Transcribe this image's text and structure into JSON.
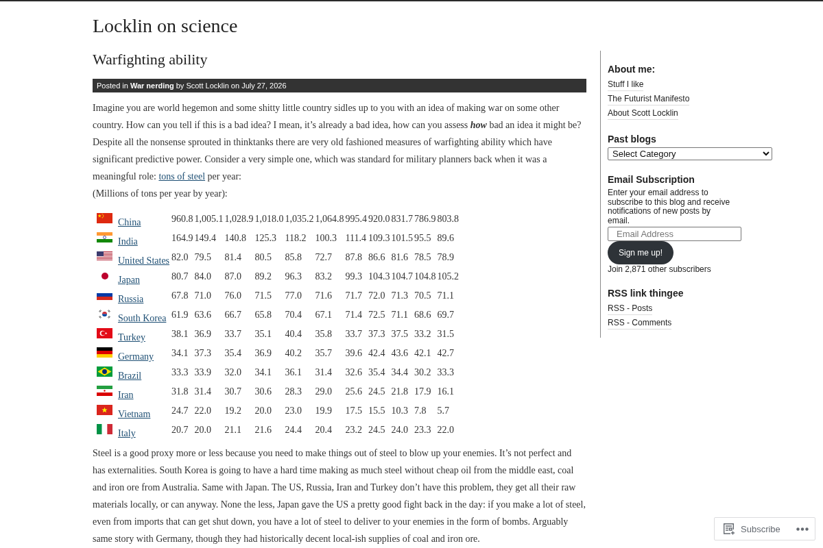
{
  "site_title": "Locklin on science",
  "post": {
    "title": "Warfighting ability",
    "meta": "Posted in **War nerding** by Scott Locklin on July 27, 2026",
    "intro": {
      "text": "Imagine you are world hegemon and some shitty little country sidles up to you with an idea of making war on some other country. How can you tell if this is a bad idea? I mean, it’s already a bad idea, how can you assess *how* bad an idea it might be? Despite all the nonsense sprouted in thinktanks there are very old fashioned measures of warfighting ability which have significant predictive power. Consider a very simple one, which was standard for military planners back when it was a meaningful role: ",
      "link": "tons of steel",
      "text_after": " per year:"
    },
    "caption": "(Millions of tons per year by year):",
    "table": {
      "rows": [
        {
          "kind": "cn",
          "country": "China",
          "values": [
            "960.8",
            "1,005.1",
            "1,028.9",
            "1,018.0",
            "1,035.2",
            "1,064.8",
            "995.4",
            "920.0",
            "831.7",
            "786.9",
            "803.8"
          ]
        },
        {
          "kind": "in",
          "country": "India",
          "values": [
            "164.9",
            "149.4",
            "140.8",
            "125.3",
            "118.2",
            "100.3",
            "111.4",
            "109.3",
            "101.5",
            "95.5",
            "89.6"
          ]
        },
        {
          "kind": "us",
          "country": "United States",
          "values": [
            "82.0",
            "79.5",
            "81.4",
            "80.5",
            "85.8",
            "72.7",
            "87.8",
            "86.6",
            "81.6",
            "78.5",
            "78.9"
          ]
        },
        {
          "kind": "jp",
          "country": "Japan",
          "values": [
            "80.7",
            "84.0",
            "87.0",
            "89.2",
            "96.3",
            "83.2",
            "99.3",
            "104.3",
            "104.7",
            "104.8",
            "105.2"
          ]
        },
        {
          "kind": "ru",
          "country": "Russia",
          "values": [
            "67.8",
            "71.0",
            "76.0",
            "71.5",
            "77.0",
            "71.6",
            "71.7",
            "72.0",
            "71.3",
            "70.5",
            "71.1"
          ]
        },
        {
          "kind": "kr",
          "country": "South Korea",
          "values": [
            "61.9",
            "63.6",
            "66.7",
            "65.8",
            "70.4",
            "67.1",
            "71.4",
            "72.5",
            "71.1",
            "68.6",
            "69.7"
          ]
        },
        {
          "kind": "tr",
          "country": "Turkey",
          "values": [
            "38.1",
            "36.9",
            "33.7",
            "35.1",
            "40.4",
            "35.8",
            "33.7",
            "37.3",
            "37.5",
            "33.2",
            "31.5"
          ]
        },
        {
          "kind": "de",
          "country": "Germany",
          "values": [
            "34.1",
            "37.3",
            "35.4",
            "36.9",
            "40.2",
            "35.7",
            "39.6",
            "42.4",
            "43.6",
            "42.1",
            "42.7"
          ]
        },
        {
          "kind": "br",
          "country": "Brazil",
          "values": [
            "33.3",
            "33.9",
            "32.0",
            "34.1",
            "36.1",
            "31.4",
            "32.6",
            "35.4",
            "34.4",
            "30.2",
            "33.3"
          ]
        },
        {
          "kind": "ir",
          "country": "Iran",
          "values": [
            "31.8",
            "31.4",
            "30.7",
            "30.6",
            "28.3",
            "29.0",
            "25.6",
            "24.5",
            "21.8",
            "17.9",
            "16.1"
          ]
        },
        {
          "kind": "vn",
          "country": "Vietnam",
          "values": [
            "24.7",
            "22.0",
            "19.2",
            "20.0",
            "23.0",
            "19.9",
            "17.5",
            "15.5",
            "10.3",
            "7.8",
            "5.7"
          ]
        },
        {
          "kind": "it",
          "country": "Italy",
          "values": [
            "20.7",
            "20.0",
            "21.1",
            "21.6",
            "24.4",
            "20.4",
            "23.2",
            "24.5",
            "24.0",
            "23.3",
            "22.0"
          ]
        }
      ]
    },
    "closing": "Steel is a good proxy more or less because you need to make things out of steel to blow up your enemies. It’s not perfect and has externalities. South Korea is going to have a hard time making as much steel without cheap oil from the middle east, coal and iron ore from Australia. Same with Japan. The US, Russia, Iran and Turkey don’t have this problem, they get all their raw materials locally, or can anyway. None the less, Japan gave the US a pretty good fight back in the day: if you make a lot of steel, even from imports that can get shut down, you have a lot of steel to deliver to your enemies in the form of bombs. Arguably same story with Germany, though they had historically decent local-ish supplies of coal and iron ore."
  },
  "sidebar": {
    "about": {
      "title": "About me:",
      "links": [
        "Stuff I like",
        "The Futurist Manifesto",
        "About Scott Locklin"
      ]
    },
    "past_blogs": {
      "title": "Past blogs",
      "select": "Select Category"
    },
    "email": {
      "title": "Email Subscription",
      "description": "Enter your email address to subscribe to this blog and receive notifications of new posts by email.",
      "placeholder": "Email Address",
      "button": "Sign me up!",
      "subscribers": "Join 2,871 other subscribers"
    },
    "rss": {
      "title": "RSS link thingee",
      "links": [
        "RSS - Posts",
        "RSS - Comments"
      ]
    }
  },
  "subscribe_bar": {
    "label": "Subscribe"
  }
}
